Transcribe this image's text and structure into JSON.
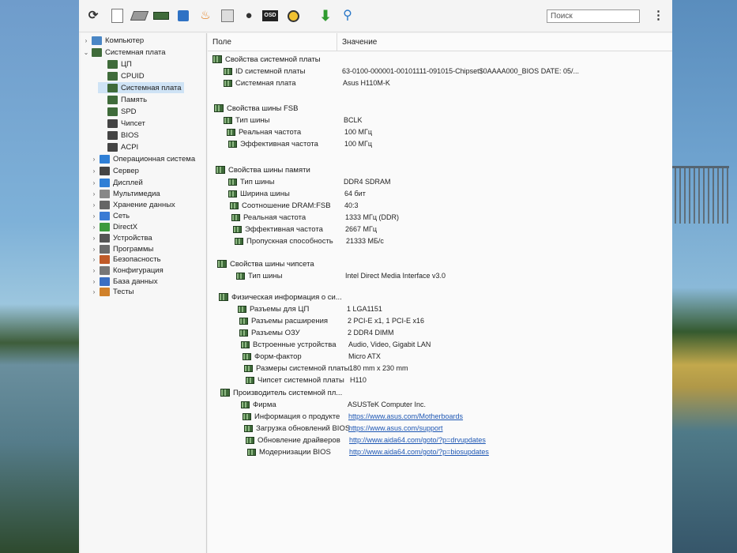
{
  "toolbar": {
    "search_placeholder": "Поиск",
    "icons": [
      "refresh-icon",
      "report-icon",
      "motherboard-chip-icon",
      "memory-icon",
      "network-icon",
      "fire-icon",
      "calendar-icon",
      "user-icon",
      "osd-icon",
      "gauge-icon",
      "download-icon",
      "search-icon"
    ]
  },
  "tree": {
    "items": [
      {
        "label": "Компьютер",
        "expander": "›",
        "icon": "computer-icon",
        "color": "#4a86c5"
      },
      {
        "label": "Системная плата",
        "expander": "⌄",
        "icon": "motherboard-icon",
        "color": "#3f6b3a"
      },
      {
        "label": "ЦП",
        "icon": "cpu-icon",
        "color": "#3f6b3a"
      },
      {
        "label": "CPUID",
        "icon": "cpuid-icon",
        "color": "#3f6b3a"
      },
      {
        "label": "Системная плата",
        "icon": "motherboard-icon",
        "color": "#3f6b3a"
      },
      {
        "label": "Память",
        "icon": "memory-icon",
        "color": "#3f6b3a"
      },
      {
        "label": "SPD",
        "icon": "spd-icon",
        "color": "#3f6b3a"
      },
      {
        "label": "Чипсет",
        "icon": "chipset-icon",
        "color": "#444444"
      },
      {
        "label": "BIOS",
        "icon": "bios-icon",
        "color": "#444444"
      },
      {
        "label": "ACPI",
        "icon": "acpi-icon",
        "color": "#444444"
      },
      {
        "label": "Операционная система",
        "expander": "›",
        "icon": "windows-icon",
        "color": "#2f7fd6"
      },
      {
        "label": "Сервер",
        "expander": "›",
        "icon": "server-icon",
        "color": "#444444"
      },
      {
        "label": "Дисплей",
        "expander": "›",
        "icon": "display-icon",
        "color": "#2f7fd6"
      },
      {
        "label": "Мультимедиа",
        "expander": "›",
        "icon": "multimedia-icon",
        "color": "#888888"
      },
      {
        "label": "Хранение данных",
        "expander": "›",
        "icon": "storage-icon",
        "color": "#666666"
      },
      {
        "label": "Сеть",
        "expander": "›",
        "icon": "network-icon",
        "color": "#3a7bd5"
      },
      {
        "label": "DirectX",
        "expander": "›",
        "icon": "xbox-icon",
        "color": "#3d9b3d"
      },
      {
        "label": "Устройства",
        "expander": "›",
        "icon": "devices-icon",
        "color": "#555555"
      },
      {
        "label": "Программы",
        "expander": "›",
        "icon": "programs-icon",
        "color": "#6b6b6b"
      },
      {
        "label": "Безопасность",
        "expander": "›",
        "icon": "shield-icon",
        "color": "#c05a28"
      },
      {
        "label": "Конфигурация",
        "expander": "›",
        "icon": "config-icon",
        "color": "#777777"
      },
      {
        "label": "База данных",
        "expander": "›",
        "icon": "database-icon",
        "color": "#3a6fc2"
      },
      {
        "label": "Тесты",
        "expander": "›",
        "icon": "tests-icon",
        "color": "#d0812a"
      }
    ]
  },
  "details": {
    "col_field": "Поле",
    "col_value": "Значение",
    "sections": [
      {
        "title": "Свойства системной платы",
        "rows": [
          {
            "field": "ID системной платы",
            "value": "63-0100-000001-00101111-091015-Chipset$0AAAA000_BIOS DATE: 05/..."
          },
          {
            "field": "Системная плата",
            "value": "Asus H110M-K"
          }
        ]
      },
      {
        "title": "Свойства шины FSB",
        "rows": [
          {
            "field": "Тип шины",
            "value": "BCLK"
          },
          {
            "field": "Реальная частота",
            "value": "100 МГц"
          },
          {
            "field": "Эффективная частота",
            "value": "100 МГц"
          }
        ]
      },
      {
        "title": "Свойства шины памяти",
        "rows": [
          {
            "field": "Тип шины",
            "value": "DDR4 SDRAM"
          },
          {
            "field": "Ширина шины",
            "value": "64 бит"
          },
          {
            "field": "Соотношение DRAM:FSB",
            "value": "40:3"
          },
          {
            "field": "Реальная частота",
            "value": "1333 МГц (DDR)"
          },
          {
            "field": "Эффективная частота",
            "value": "2667 МГц"
          },
          {
            "field": "Пропускная способность",
            "value": "21333 МБ/с"
          }
        ]
      },
      {
        "title": "Свойства шины чипсета",
        "rows": [
          {
            "field": "Тип шины",
            "value": "Intel Direct Media Interface v3.0"
          }
        ]
      },
      {
        "title": "Физическая информация о си...",
        "rows": [
          {
            "field": "Разъемы для ЦП",
            "value": "1 LGA1151"
          },
          {
            "field": "Разъемы расширения",
            "value": "2 PCI-E x1, 1 PCI-E x16"
          },
          {
            "field": "Разъемы ОЗУ",
            "value": "2 DDR4 DIMM"
          },
          {
            "field": "Встроенные устройства",
            "value": "Audio, Video, Gigabit LAN"
          },
          {
            "field": "Форм-фактор",
            "value": "Micro ATX"
          },
          {
            "field": "Размеры системной платы",
            "value": "180 mm x 230 mm"
          },
          {
            "field": "Чипсет системной платы",
            "value": "H110"
          }
        ]
      },
      {
        "title": "Производитель системной пл...",
        "rows": [
          {
            "field": "Фирма",
            "value": "ASUSTeK Computer Inc."
          },
          {
            "field": "Информация о продукте",
            "value": "https://www.asus.com/Motherboards",
            "link": true
          },
          {
            "field": "Загрузка обновлений BIOS",
            "value": "https://www.asus.com/support",
            "link": true
          },
          {
            "field": "Обновление драйверов",
            "value": "http://www.aida64.com/goto/?p=drvupdates",
            "link": true
          },
          {
            "field": "Модернизации BIOS",
            "value": "http://www.aida64.com/goto/?p=biosupdates",
            "link": true
          }
        ]
      }
    ]
  }
}
